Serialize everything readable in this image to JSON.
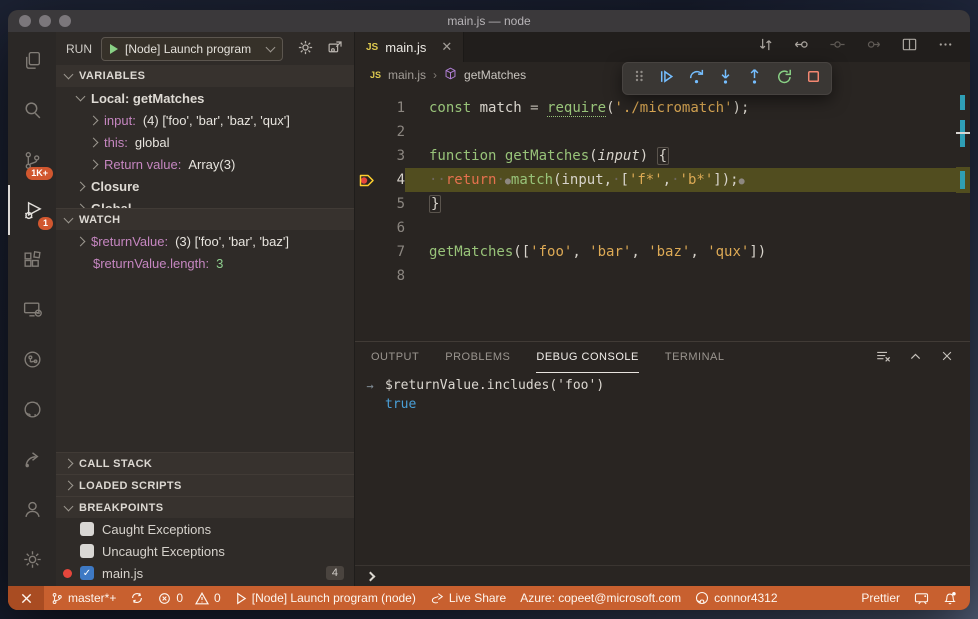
{
  "window": {
    "title": "main.js — node"
  },
  "activity_bar": {
    "badges": {
      "source_control": "1K+",
      "debug": "1"
    }
  },
  "run_bar": {
    "label": "RUN",
    "config": "[Node] Launch program"
  },
  "variables": {
    "header": "VARIABLES",
    "rows": [
      {
        "chev": "v",
        "indent": 1,
        "label": "Local: getMatches"
      },
      {
        "chev": ">",
        "indent": 2,
        "name": "input:",
        "value": "(4) ['foo', 'bar', 'baz', 'qux']"
      },
      {
        "chev": ">",
        "indent": 2,
        "name": "this:",
        "value": "global"
      },
      {
        "chev": ">",
        "indent": 2,
        "name": "Return value:",
        "value": "Array(3)"
      },
      {
        "chev": ">",
        "indent": 1,
        "label": "Closure"
      },
      {
        "chev": ">",
        "indent": 1,
        "label": "Global"
      }
    ]
  },
  "watch": {
    "header": "WATCH",
    "rows": [
      {
        "chev": ">",
        "indent": 1,
        "name": "$returnValue:",
        "value": "(3) ['foo', 'bar', 'baz']"
      },
      {
        "chev": "",
        "indent": 1,
        "name": "$returnValue.length:",
        "num": "3"
      }
    ]
  },
  "sections": {
    "call_stack": "CALL STACK",
    "loaded_scripts": "LOADED SCRIPTS",
    "breakpoints": "BREAKPOINTS"
  },
  "breakpoints": {
    "items": [
      {
        "checked": false,
        "label": "Caught Exceptions"
      },
      {
        "checked": false,
        "label": "Uncaught Exceptions"
      },
      {
        "checked": true,
        "dot": true,
        "label": "main.js",
        "badge": "4"
      }
    ]
  },
  "editor": {
    "js_badge": "JS",
    "tab": {
      "label": "main.js"
    },
    "breadcrumb": {
      "file": "main.js",
      "symbol": "getMatches"
    },
    "lines": [
      {
        "num": "1",
        "segs": [
          [
            "kw",
            "const"
          ],
          [
            "pl",
            " match "
          ],
          [
            "op",
            "="
          ],
          [
            "pl",
            " "
          ],
          [
            "fnu",
            "require"
          ],
          [
            "pl",
            "("
          ],
          [
            "st",
            "'./micromatch'"
          ],
          [
            "pl",
            ");"
          ]
        ]
      },
      {
        "num": "2",
        "segs": []
      },
      {
        "num": "3",
        "segs": [
          [
            "kw",
            "function"
          ],
          [
            "pl",
            " "
          ],
          [
            "fn",
            "getMatches"
          ],
          [
            "pl",
            "("
          ],
          [
            "pr",
            "input"
          ],
          [
            "pl",
            ") "
          ],
          [
            "bb",
            "{"
          ]
        ]
      },
      {
        "num": "4",
        "hl": true,
        "cur": true,
        "segs": [
          [
            "ws",
            "··"
          ],
          [
            "rt",
            "return"
          ],
          [
            "ws",
            "·"
          ],
          [
            "ib",
            "●"
          ],
          [
            "fn",
            "match"
          ],
          [
            "pl",
            "(input,"
          ],
          [
            "ws",
            "·"
          ],
          [
            "pl",
            "["
          ],
          [
            "st",
            "'f*'"
          ],
          [
            "pl",
            ","
          ],
          [
            "ws",
            "·"
          ],
          [
            "st",
            "'b*'"
          ],
          [
            "pl",
            "]);"
          ],
          [
            "ib",
            "●"
          ]
        ]
      },
      {
        "num": "5",
        "segs": [
          [
            "bb",
            "}"
          ]
        ]
      },
      {
        "num": "6",
        "segs": []
      },
      {
        "num": "7",
        "segs": [
          [
            "fn",
            "getMatches"
          ],
          [
            "pl",
            "(["
          ],
          [
            "st",
            "'foo'"
          ],
          [
            "pl",
            ", "
          ],
          [
            "st",
            "'bar'"
          ],
          [
            "pl",
            ", "
          ],
          [
            "st",
            "'baz'"
          ],
          [
            "pl",
            ", "
          ],
          [
            "st",
            "'qux'"
          ],
          [
            "pl",
            "])"
          ]
        ]
      },
      {
        "num": "8",
        "segs": []
      }
    ]
  },
  "panel": {
    "tabs": [
      {
        "label": "OUTPUT"
      },
      {
        "label": "PROBLEMS"
      },
      {
        "label": "DEBUG CONSOLE",
        "active": true
      },
      {
        "label": "TERMINAL"
      }
    ],
    "console": {
      "arrow": "→",
      "expression": "$returnValue.includes('foo')",
      "result": "true"
    }
  },
  "status_bar": {
    "branch": "master*+",
    "errors": "0",
    "warnings": "0",
    "launch": "[Node] Launch program (node)",
    "live_share": "Live Share",
    "azure": "Azure: copeet@microsoft.com",
    "account": "connor4312",
    "prettier": "Prettier"
  },
  "colors": {
    "status_bar": "#c8602f",
    "badge": "#d1572f",
    "debug_blue": "#75beff",
    "debug_green": "#89d185",
    "debug_red": "#f48771",
    "variable_purple": "#c586c0",
    "string_amber": "#ddaa55",
    "keyword_green": "#98c379",
    "line_highlight": "#514d1f",
    "console_blue": "#4aa0d8"
  }
}
